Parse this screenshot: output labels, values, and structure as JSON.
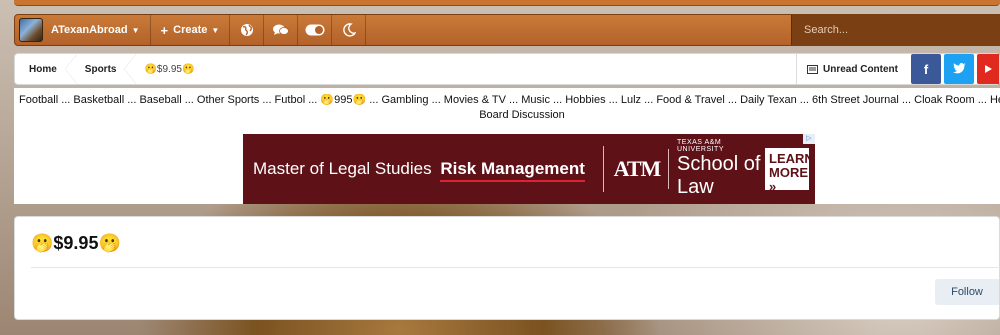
{
  "nav": {
    "username": "ATexanAbroad",
    "create_label": "Create",
    "search_placeholder": "Search..."
  },
  "breadcrumb": {
    "home": "Home",
    "sports": "Sports",
    "current": "🫢$9.95🫢"
  },
  "actions": {
    "unread_label": "Unread Content",
    "facebook": "f",
    "twitter": "t"
  },
  "forum_links": {
    "line1": "Football ... Basketball ... Baseball ... Other Sports ... Futbol ... 🫢995🫢 ... Gambling ... Movies & TV ... Music ... Hobbies ... Lulz ... Food & Travel ... Daily Texan ... 6th Street Journal ... Cloak Room ... Help ... Fo",
    "line2": "Board Discussion"
  },
  "ad": {
    "left_text": "Master of Legal Studies",
    "left_bold": "Risk Management",
    "logo": "ATM",
    "school_small": "TEXAS A&M UNIVERSITY",
    "school_name": "School of Law",
    "cta": "LEARN MORE »"
  },
  "topic": {
    "title": "🫢$9.95🫢",
    "follow_label": "Follow"
  }
}
